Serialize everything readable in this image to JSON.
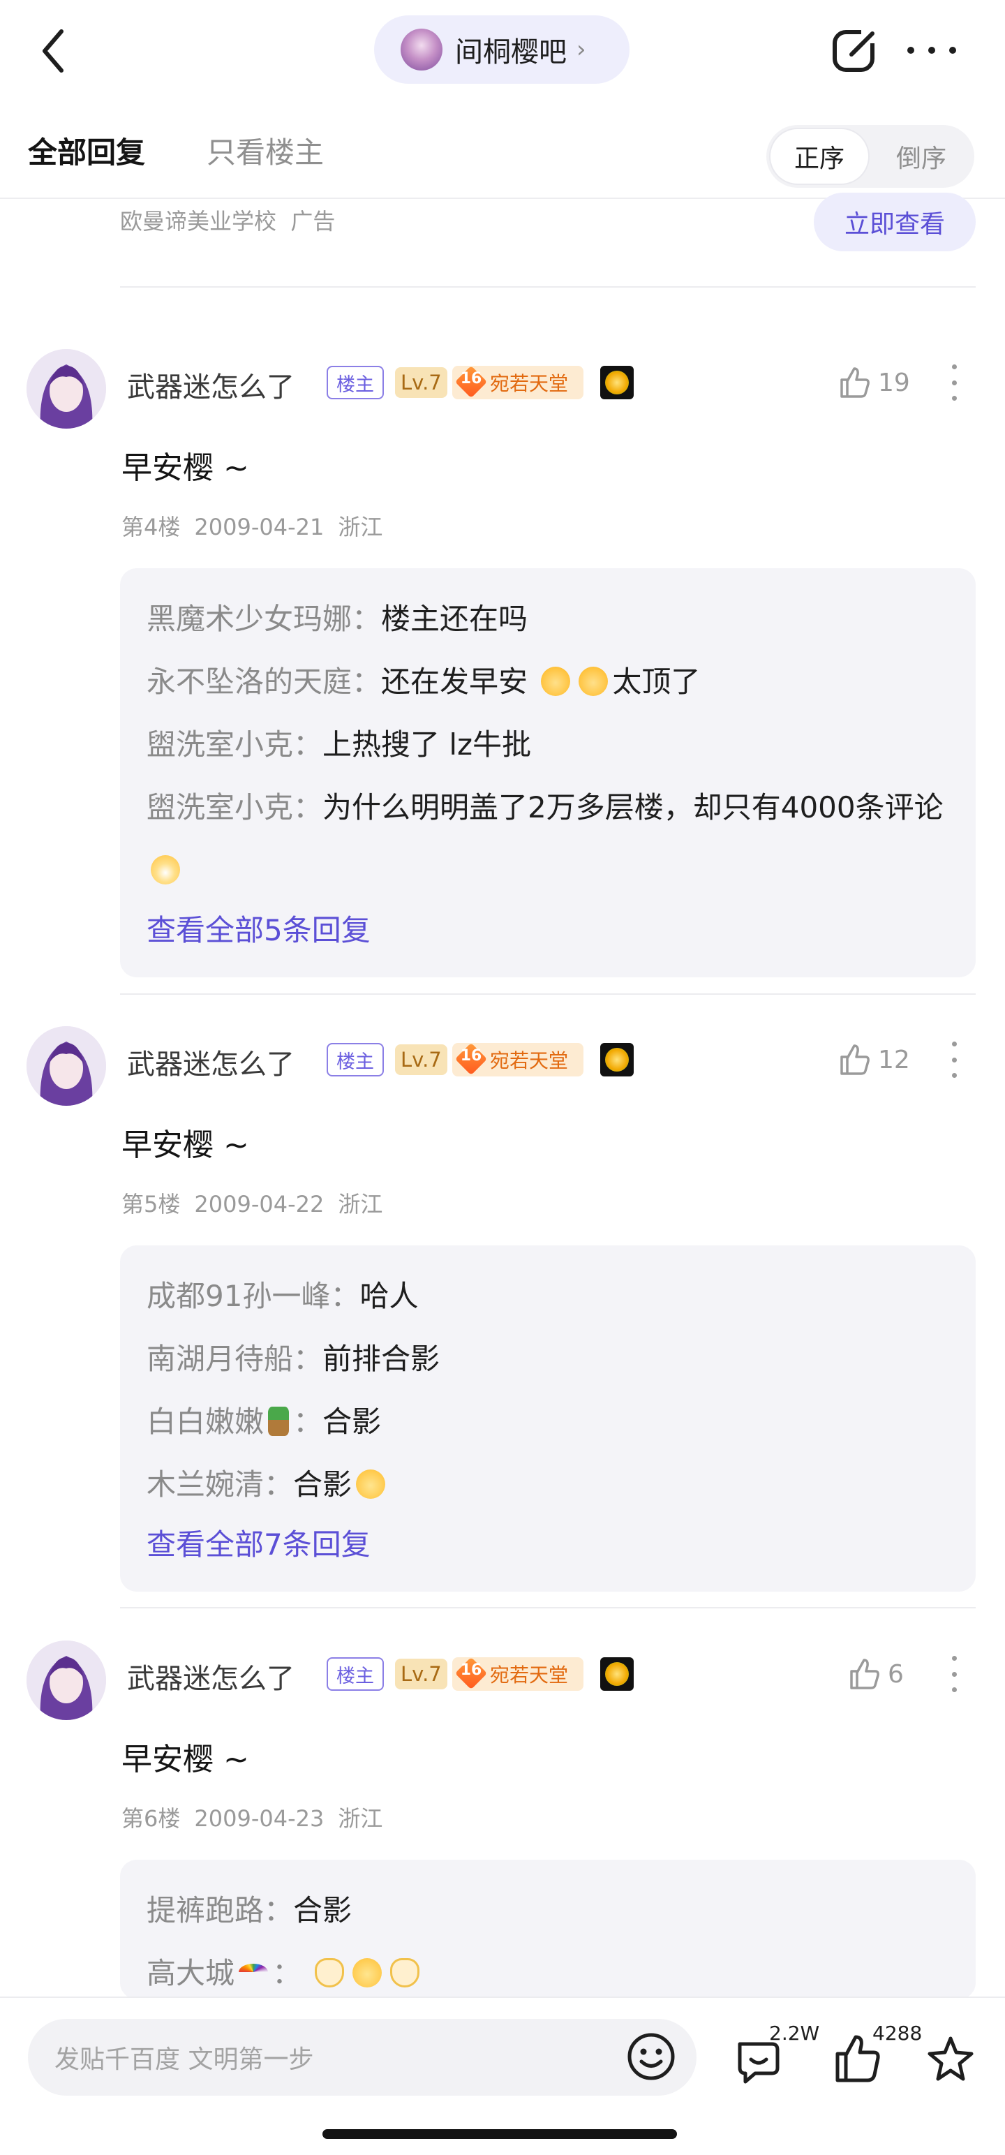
{
  "header": {
    "forum_name": "间桐樱吧",
    "chevron": "›"
  },
  "sort": {
    "tab_all": "全部回复",
    "tab_op": "只看楼主",
    "order_asc": "正序",
    "order_desc": "倒序"
  },
  "ad": {
    "source": "欧曼谛美业学校",
    "label": "广告",
    "button": "立即查看"
  },
  "badges": {
    "op": "楼主",
    "level": "Lv.7",
    "rank_num": "16",
    "rank_title": "宛若天堂"
  },
  "posts": [
    {
      "username": "武器迷怎么了",
      "likes": "19",
      "text": "早安樱 ~",
      "floor": "第4楼",
      "date": "2009-04-21",
      "location": "浙江",
      "replies": [
        {
          "author": "黑魔术少女玛娜：",
          "text": "楼主还在吗"
        },
        {
          "author": "永不坠洛的天庭：",
          "text": "还在发早安",
          "text2": "太顶了"
        },
        {
          "author": "盥洗室小克：",
          "text": "上热搜了 lz牛批"
        },
        {
          "author": "盥洗室小克：",
          "text": "为什么明明盖了2万多层楼，却只有4000条评论"
        }
      ],
      "more": "查看全部5条回复"
    },
    {
      "username": "武器迷怎么了",
      "likes": "12",
      "text": "早安樱 ~",
      "floor": "第5楼",
      "date": "2009-04-22",
      "location": "浙江",
      "replies": [
        {
          "author": "成都91孙一峰：",
          "text": "哈人"
        },
        {
          "author": "南湖月待船：",
          "text": "前排合影"
        },
        {
          "author": "白白嫩嫩",
          "author2": "：",
          "text": "合影"
        },
        {
          "author": "木兰婉清：",
          "text": "合影"
        }
      ],
      "more": "查看全部7条回复"
    },
    {
      "username": "武器迷怎么了",
      "likes": "6",
      "text": "早安樱 ~",
      "floor": "第6楼",
      "date": "2009-04-23",
      "location": "浙江",
      "replies": [
        {
          "author": "提裤跑路：",
          "text": "合影"
        },
        {
          "author": "高大城",
          "author2": "："
        }
      ]
    }
  ],
  "bottom": {
    "input_placeholder": "发贴千百度 文明第一步",
    "comments_count": "2.2W",
    "likes_count": "4288"
  },
  "icons": [
    "back-icon",
    "edit-icon",
    "more-icon",
    "like-icon",
    "emoji-icon",
    "comment-icon",
    "thumb-icon",
    "star-icon"
  ],
  "colors": {
    "accent": "#5b4fd6",
    "pill_bg": "#eeeefc",
    "reply_bg": "#f4f4f8",
    "rank_orange": "#e26a10"
  }
}
